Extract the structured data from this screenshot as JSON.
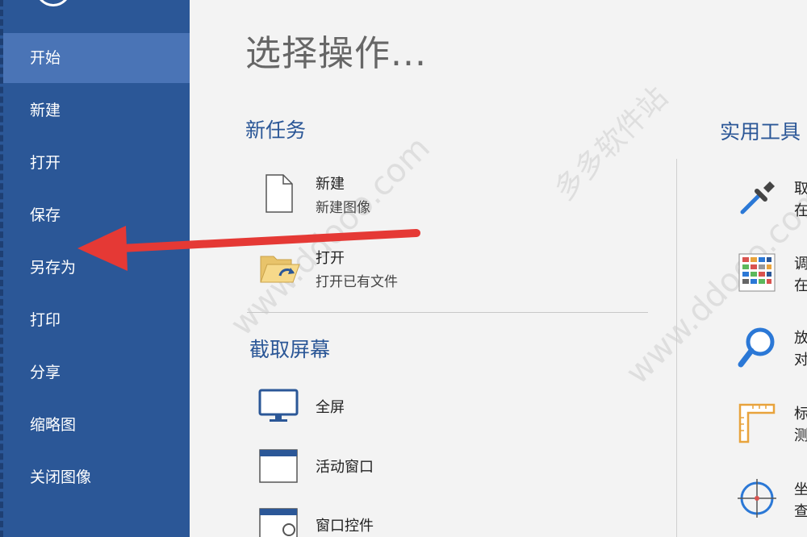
{
  "sidebar": {
    "items": [
      {
        "label": "开始",
        "active": true
      },
      {
        "label": "新建"
      },
      {
        "label": "打开"
      },
      {
        "label": "保存"
      },
      {
        "label": "另存为"
      },
      {
        "label": "打印"
      },
      {
        "label": "分享"
      },
      {
        "label": "缩略图"
      },
      {
        "label": "关闭图像"
      }
    ]
  },
  "main": {
    "title": "选择操作...",
    "new_task": {
      "heading": "新任务",
      "items": [
        {
          "title": "新建",
          "subtitle": "新建图像",
          "icon": "blank-document-icon"
        },
        {
          "title": "打开",
          "subtitle": "打开已有文件",
          "icon": "open-folder-icon"
        }
      ]
    },
    "capture": {
      "heading": "截取屏幕",
      "items": [
        {
          "title": "全屏",
          "icon": "monitor-icon"
        },
        {
          "title": "活动窗口",
          "icon": "window-icon"
        },
        {
          "title": "窗口控件",
          "icon": "window-control-icon"
        }
      ]
    },
    "tools": {
      "heading": "实用工具",
      "items": [
        {
          "title": "取",
          "subtitle": "在",
          "icon": "eyedropper-icon"
        },
        {
          "title": "调",
          "subtitle": "在",
          "icon": "color-palette-icon"
        },
        {
          "title": "放",
          "subtitle": "对",
          "icon": "magnifier-icon"
        },
        {
          "title": "标",
          "subtitle": "测",
          "icon": "ruler-icon"
        },
        {
          "title": "坐",
          "subtitle": "查",
          "icon": "crosshair-icon"
        }
      ]
    }
  },
  "watermarks": [
    "www.ddooo.com",
    "多多软件站"
  ],
  "colors": {
    "sidebar": "#2b5797",
    "sidebar_active": "#4a74b6",
    "accent": "#2b5797",
    "arrow": "#e53935"
  }
}
